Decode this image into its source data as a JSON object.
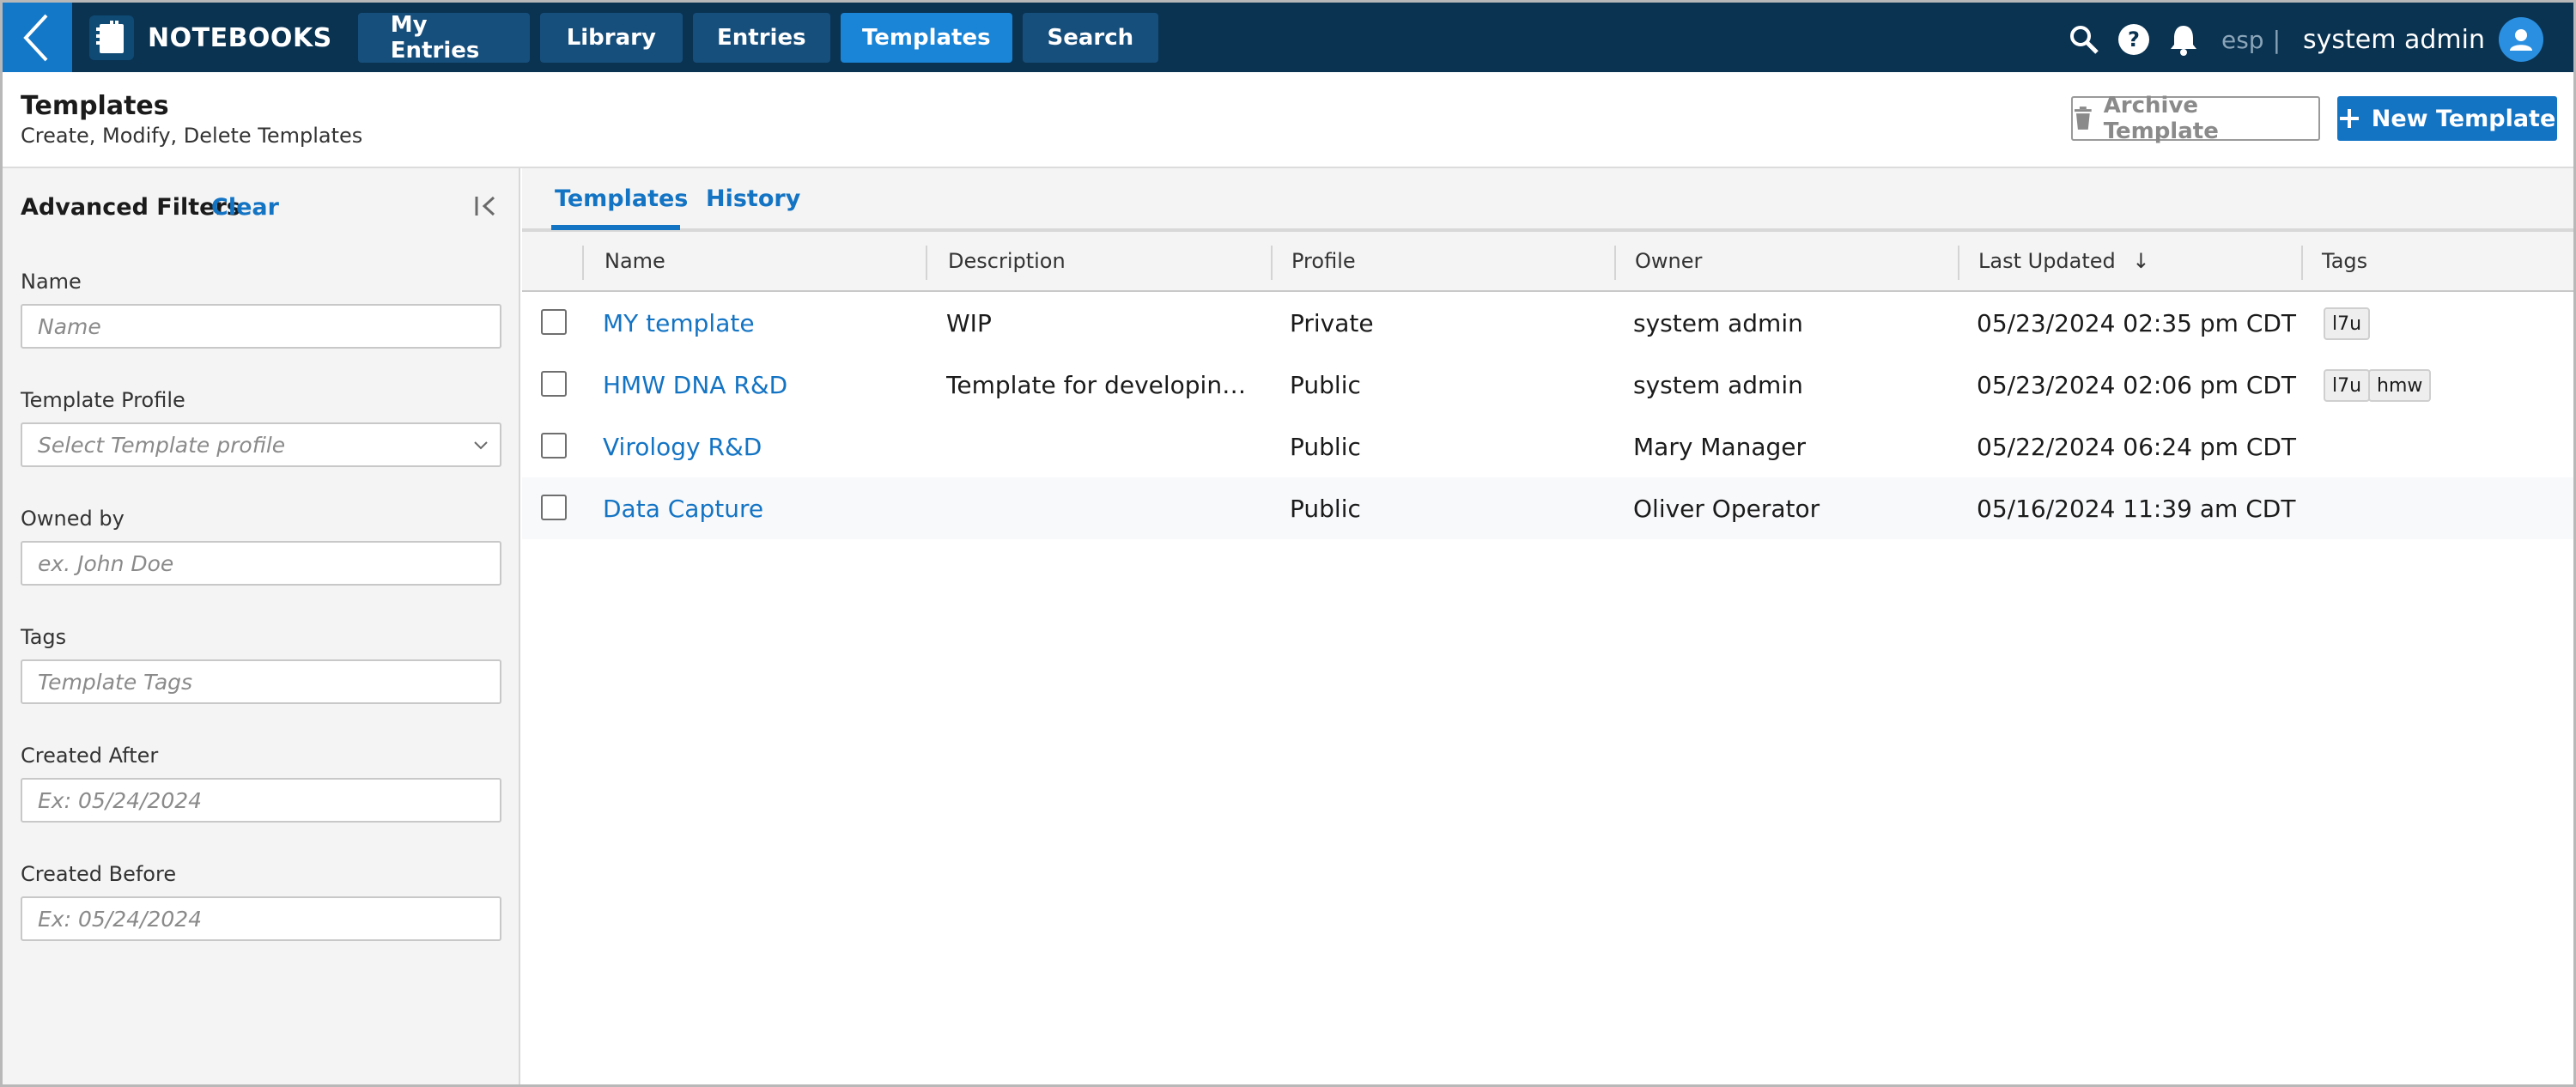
{
  "app": {
    "name": "NOTEBOOKS",
    "nav": [
      {
        "label": "My Entries",
        "active": false
      },
      {
        "label": "Library",
        "active": false
      },
      {
        "label": "Entries",
        "active": false
      },
      {
        "label": "Templates",
        "active": true
      },
      {
        "label": "Search",
        "active": false
      }
    ],
    "lang": "esp",
    "lang_sep": "|",
    "user": "system admin"
  },
  "header": {
    "title": "Templates",
    "subtitle": "Create, Modify, Delete Templates",
    "archive_label": "Archive Template",
    "new_label": "New Template"
  },
  "filters": {
    "title": "Advanced Filters",
    "clear": "Clear",
    "name_label": "Name",
    "name_placeholder": "Name",
    "profile_label": "Template Profile",
    "profile_placeholder": "Select Template profile",
    "owned_label": "Owned by",
    "owned_placeholder": "ex. John Doe",
    "tags_label": "Tags",
    "tags_placeholder": "Template Tags",
    "after_label": "Created After",
    "after_placeholder": "Ex: 05/24/2024",
    "before_label": "Created Before",
    "before_placeholder": "Ex: 05/24/2024"
  },
  "tabs": {
    "templates": "Templates",
    "history": "History"
  },
  "table": {
    "columns": {
      "name": "Name",
      "description": "Description",
      "profile": "Profile",
      "owner": "Owner",
      "last_updated": "Last Updated",
      "tags": "Tags"
    },
    "sort_arrow": "↓",
    "rows": [
      {
        "name": "MY template",
        "description": "WIP",
        "profile": "Private",
        "owner": "system admin",
        "last_updated": "05/23/2024 02:35 pm CDT",
        "tags": [
          "l7u"
        ]
      },
      {
        "name": "HMW DNA R&D",
        "description": "Template for developing ...",
        "profile": "Public",
        "owner": "system admin",
        "last_updated": "05/23/2024 02:06 pm CDT",
        "tags": [
          "l7u",
          "hmw"
        ]
      },
      {
        "name": "Virology R&D",
        "description": "",
        "profile": "Public",
        "owner": "Mary Manager",
        "last_updated": "05/22/2024 06:24 pm CDT",
        "tags": []
      },
      {
        "name": "Data Capture",
        "description": "",
        "profile": "Public",
        "owner": "Oliver Operator",
        "last_updated": "05/16/2024 11:39 am CDT",
        "tags": []
      }
    ]
  },
  "colors": {
    "navbar": "#0a3352",
    "accent": "#1474c4",
    "active_tab": "#1a84d6"
  }
}
